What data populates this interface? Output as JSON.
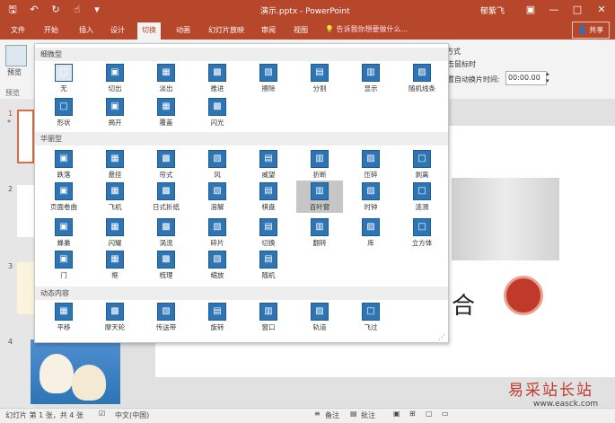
{
  "window": {
    "title": "演示.pptx - PowerPoint",
    "user": "郁紫飞"
  },
  "tabs": [
    "文件",
    "开始",
    "插入",
    "设计",
    "切换",
    "动画",
    "幻灯片放映",
    "审阅",
    "视图"
  ],
  "tell_me": "告诉我你想要做什么...",
  "share": "共享",
  "ribbon": {
    "preview_label": "预览",
    "preview_group": "预览",
    "advance_header": "方式",
    "on_click": "单击鼠标时",
    "after_label": "设置自动换片时间:",
    "after_value": "00:00.00"
  },
  "gallery": {
    "sections": [
      {
        "title": "细微型",
        "items": [
          "无",
          "切出",
          "淡出",
          "推进",
          "擦除",
          "分割",
          "显示",
          "随机线条",
          "形状",
          "揭开",
          "覆盖",
          "闪光"
        ]
      },
      {
        "title": "华丽型",
        "items": [
          "跌落",
          "悬挂",
          "帘式",
          "风",
          "威望",
          "折断",
          "压碎",
          "剥离",
          "页面卷曲",
          "飞机",
          "日式折纸",
          "溶解",
          "棋盘",
          "百叶窗",
          "时钟",
          "涟漪",
          "蜂巢",
          "闪耀",
          "涡流",
          "碎片",
          "切换",
          "翻转",
          "库",
          "立方体",
          "门",
          "框",
          "梳理",
          "缩放",
          "随机"
        ]
      },
      {
        "title": "动态内容",
        "items": [
          "平移",
          "摩天轮",
          "传送带",
          "旋转",
          "窗口",
          "轨道",
          "飞过"
        ]
      }
    ],
    "selected": "百叶窗"
  },
  "thumbnails": [
    "1",
    "2",
    "3",
    "4"
  ],
  "slide_char": "合",
  "status": {
    "slide_info": "幻灯片 第 1 张，共 4 张",
    "language": "中文(中国)",
    "notes": "备注",
    "comments": "批注"
  },
  "watermark": {
    "text": "易采站长站",
    "url": "www.easck.com"
  },
  "colors": {
    "accent": "#b7472a",
    "icon_blue": "#2e75b6"
  }
}
